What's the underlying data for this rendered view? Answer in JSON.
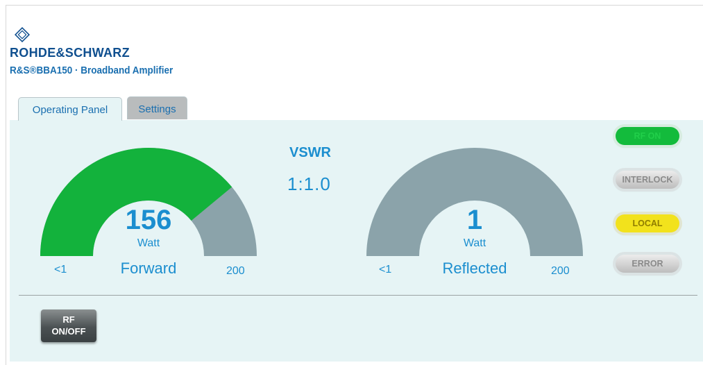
{
  "header": {
    "brand": "ROHDE&SCHWARZ",
    "product": "R&S®BBA150 · Broadband Amplifier",
    "logo_icon": "rs-diamond-logo-icon"
  },
  "tabs": [
    {
      "label": "Operating Panel",
      "active": true
    },
    {
      "label": "Settings",
      "active": false
    }
  ],
  "gauges": {
    "forward": {
      "value": "156",
      "unit": "Watt",
      "label": "Forward",
      "min_label": "<1",
      "max_label": "200",
      "level": 156,
      "max": 200,
      "fill_color": "#13b23c",
      "track_color": "#8ba3aa"
    },
    "reflected": {
      "value": "1",
      "unit": "Watt",
      "label": "Reflected",
      "min_label": "<1",
      "max_label": "200",
      "level": 1,
      "max": 200,
      "fill_color": "#13b23c",
      "track_color": "#8ba3aa"
    }
  },
  "vswr": {
    "title": "VSWR",
    "value": "1:1.0"
  },
  "indicators": [
    {
      "label": "RF ON",
      "state": "on",
      "color": "#13bb3c"
    },
    {
      "label": "INTERLOCK",
      "state": "off",
      "color": "#d0d0d0"
    },
    {
      "label": "LOCAL",
      "state": "on",
      "color": "#f2e21c"
    },
    {
      "label": "ERROR",
      "state": "off",
      "color": "#d0d0d0"
    }
  ],
  "controls": {
    "rf_button_line1": "RF",
    "rf_button_line2": "ON/OFF"
  },
  "colors": {
    "accent_text": "#1b8ecf",
    "panel_bg": "#e6f4f5",
    "brand": "#0f4f8f"
  }
}
